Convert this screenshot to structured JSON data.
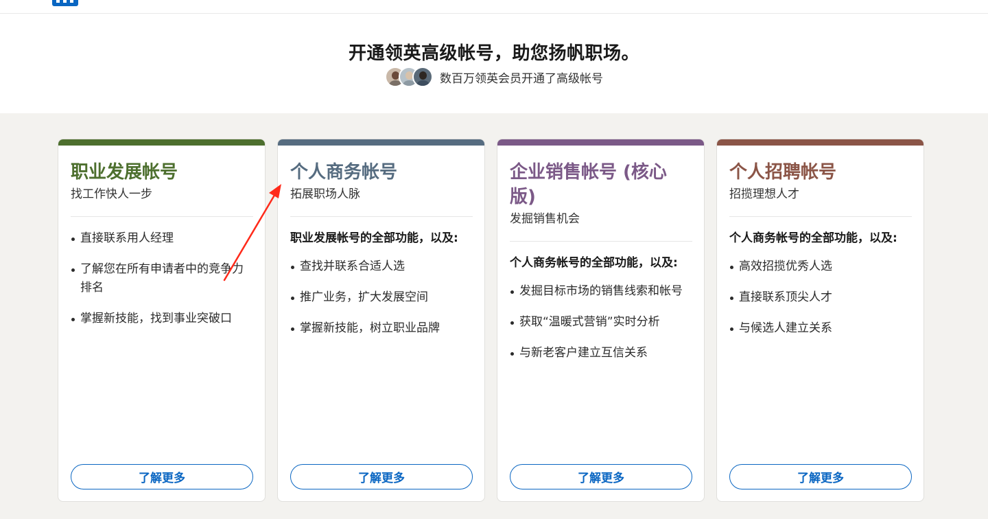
{
  "header": {
    "logo": "linkedin-logo-icon"
  },
  "hero": {
    "title": "开通领英高级帐号，助您扬帆职场。",
    "subtitle": "数百万领英会员开通了高级帐号"
  },
  "colors": {
    "career": "#4d6f2e",
    "business": "#566c80",
    "sales": "#7b5987",
    "recruiter": "#8b5547",
    "button": "#0a66c2",
    "annotation_arrow": "#ff2a1a"
  },
  "plans": [
    {
      "title": "职业发展帐号",
      "tagline": "找工作快人一步",
      "lead": "",
      "features": [
        "直接联系用人经理",
        "了解您在所有申请者中的竞争力排名",
        "掌握新技能，找到事业突破口"
      ],
      "button": "了解更多"
    },
    {
      "title": "个人商务帐号",
      "tagline": "拓展职场人脉",
      "lead": "职业发展帐号的全部功能，以及:",
      "features": [
        "查找并联系合适人选",
        "推广业务，扩大发展空间",
        "掌握新技能，树立职业品牌"
      ],
      "button": "了解更多"
    },
    {
      "title": "企业销售帐号 (核心版)",
      "tagline": "发掘销售机会",
      "lead": "个人商务帐号的全部功能，以及:",
      "features": [
        "发掘目标市场的销售线索和帐号",
        "获取“温暖式营销”实时分析",
        "与新老客户建立互信关系"
      ],
      "button": "了解更多"
    },
    {
      "title": "个人招聘帐号",
      "tagline": "招揽理想人才",
      "lead": "个人商务帐号的全部功能，以及:",
      "features": [
        "高效招揽优秀人选",
        "直接联系顶尖人才",
        "与候选人建立关系"
      ],
      "button": "了解更多"
    }
  ]
}
